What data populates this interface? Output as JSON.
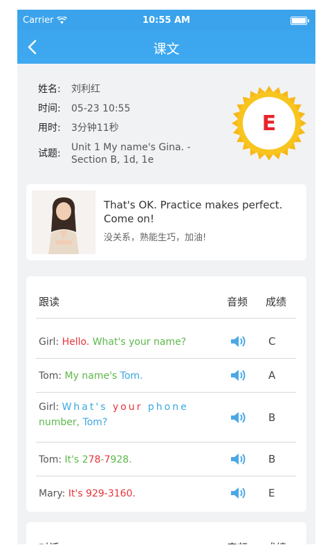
{
  "status": {
    "carrier": "Carrier",
    "time": "10:55 AM"
  },
  "nav": {
    "title": "课文"
  },
  "info": {
    "name_label": "姓名:",
    "name": "刘利红",
    "time_label": "时间:",
    "time": "05-23 10:55",
    "used_label": "用时:",
    "used": "3分钟11秒",
    "q_label": "试题:",
    "q": "Unit 1 My name's Gina. - Section B, 1d, 1e"
  },
  "grade": "E",
  "coach": {
    "en": "That's OK. Practice makes perfect. Come on!",
    "cn": "没关系，熟能生巧，加油!"
  },
  "table": {
    "title": "跟读",
    "col_audio": "音频",
    "col_score": "成绩",
    "rows": [
      {
        "segs": [
          [
            "Girl: ",
            ""
          ],
          [
            "Hello. ",
            "red"
          ],
          [
            "What's your name?",
            "green"
          ]
        ],
        "score": "C"
      },
      {
        "segs": [
          [
            "Tom: ",
            ""
          ],
          [
            "My name's ",
            "green"
          ],
          [
            "Tom.",
            "blue"
          ]
        ],
        "score": "A"
      },
      {
        "segs": [
          [
            "Girl: ",
            ""
          ],
          [
            "What's ",
            "blue spaced"
          ],
          [
            "your ",
            "red spaced"
          ],
          [
            "phone ",
            "blue spaced"
          ],
          [
            "number, ",
            "green"
          ],
          [
            "Tom?",
            "blue"
          ]
        ],
        "score": "B"
      },
      {
        "segs": [
          [
            "Tom: ",
            ""
          ],
          [
            "It's 2",
            "green"
          ],
          [
            "78",
            "red"
          ],
          [
            "-",
            "green"
          ],
          [
            "7",
            "red"
          ],
          [
            "928.",
            "green"
          ]
        ],
        "score": "B"
      },
      {
        "segs": [
          [
            "Mary: ",
            ""
          ],
          [
            "It's 929-3160.",
            "red"
          ]
        ],
        "score": "E"
      }
    ]
  },
  "table2": {
    "title": "对话",
    "col_audio": "音频",
    "col_score": "成绩"
  },
  "colors": {
    "accent": "#3aa3ec",
    "grade": "#e8242a",
    "badge": "#f7b818"
  }
}
